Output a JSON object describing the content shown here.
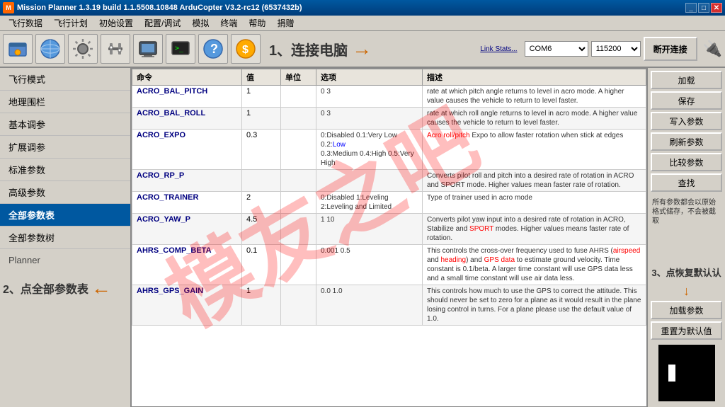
{
  "titleBar": {
    "title": "Mission Planner 1.3.19 build 1.1.5508.10848 ArduCopter V3.2-rc12 (6537432b)",
    "icon": "MP"
  },
  "menuBar": {
    "items": [
      "飞行数据",
      "飞行计划",
      "初始设置",
      "配置/调试",
      "模拟",
      "终端",
      "帮助",
      "捐赠"
    ]
  },
  "toolbar": {
    "icons": [
      {
        "name": "fly-data-icon",
        "symbol": "✈"
      },
      {
        "name": "flight-plan-icon",
        "symbol": "🌐"
      },
      {
        "name": "initial-setup-icon",
        "symbol": "⚙"
      },
      {
        "name": "config-icon",
        "symbol": "🔧"
      },
      {
        "name": "simulation-icon",
        "symbol": "🖥"
      },
      {
        "name": "terminal-icon",
        "symbol": "📟"
      },
      {
        "name": "help-icon",
        "symbol": "❓"
      },
      {
        "name": "donate-icon",
        "symbol": "💰"
      }
    ],
    "connectLabel": "1、连接电脑",
    "comPort": "COM6",
    "baudRate": "115200",
    "connectBtnLabel": "断开连接",
    "linkStats": "Link Stats..."
  },
  "sidebar": {
    "items": [
      {
        "label": "飞行模式",
        "active": false
      },
      {
        "label": "地理围栏",
        "active": false
      },
      {
        "label": "基本调参",
        "active": false
      },
      {
        "label": "扩展调参",
        "active": false
      },
      {
        "label": "标准参数",
        "active": false
      },
      {
        "label": "高级参数",
        "active": false
      },
      {
        "label": "全部参数表",
        "active": true
      },
      {
        "label": "全部参数树",
        "active": false
      }
    ],
    "plannerLabel": "Planner"
  },
  "tableHeaders": [
    "命令",
    "值",
    "单位",
    "选项",
    "描述"
  ],
  "tableRows": [
    {
      "name": "ACRO_BAL_PITCH",
      "value": "1",
      "unit": "",
      "options": "0 3",
      "description": "rate at which pitch angle returns to level in acro mode.  A higher value causes the vehicle to return to level faster."
    },
    {
      "name": "ACRO_BAL_ROLL",
      "value": "1",
      "unit": "",
      "options": "0 3",
      "description": "rate at which roll angle returns to level in acro mode.  A higher value causes the vehicle to return to level faster."
    },
    {
      "name": "ACRO_EXPO",
      "value": "0.3",
      "unit": "",
      "options": "0:Disabled 0.1:Very Low 0.2:Low 0.3:Medium 0.4:High 0.5:Very High",
      "description": "Acro roll/pitch Expo to allow faster rotation when stick at edges",
      "hasRedText": true,
      "redParts": [
        "Acro roll/pitch"
      ]
    },
    {
      "name": "ACRO_RP_P",
      "value": "",
      "unit": "",
      "options": "",
      "description": "Converts pilot roll and pitch into a desired rate of rotation in ACRO and SPORT mode.  Higher values mean faster rate of rotation."
    },
    {
      "name": "ACRO_TRAINER",
      "value": "2",
      "unit": "",
      "options": "0:Disabled 1:Leveling 2:Leveling and Limited",
      "description": "Type of trainer used in acro mode"
    },
    {
      "name": "ACRO_YAW_P",
      "value": "4.5",
      "unit": "",
      "options": "1 10",
      "description": "Converts pilot yaw input into a desired rate of rotation in ACRO, Stabilize and SPORT modes.  Higher values means faster rate of rotation.",
      "hasRedText": true,
      "redParts": [
        "SPORT"
      ]
    },
    {
      "name": "AHRS_COMP_BETA",
      "value": "0.1",
      "unit": "",
      "options": "0.001 0.5",
      "description": "This controls the cross-over frequency used to fuse AHRS (airspeed and heading) and GPS data to estimate ground velocity. Time constant is 0.1/beta. A larger time constant will use GPS data less and a small time constant will use air data less.",
      "hasRedText": true,
      "redParts": [
        "airspeed",
        "heading",
        "GPS data"
      ]
    },
    {
      "name": "AHRS_GPS_GAIN",
      "value": "1",
      "unit": "",
      "options": "0.0 1.0",
      "description": "This controls how much to use the GPS to correct the attitude. This should never be set to zero for a plane as it would result in the plane losing control in turns. For a plane please use the default value of 1.0."
    }
  ],
  "rightPanel": {
    "buttons": [
      {
        "label": "加载",
        "name": "load-btn"
      },
      {
        "label": "保存",
        "name": "save-btn"
      },
      {
        "label": "写入参数",
        "name": "write-params-btn"
      },
      {
        "label": "刷新参数",
        "name": "refresh-params-btn"
      },
      {
        "label": "比较参数",
        "name": "compare-params-btn"
      },
      {
        "label": "查找",
        "name": "find-btn"
      }
    ],
    "note": "所有参数都会以原始格式储存，不会被截取",
    "bottomButtons": [
      {
        "label": "加载参数",
        "name": "load-params-btn"
      },
      {
        "label": "重置为默认值",
        "name": "reset-default-btn"
      }
    ]
  },
  "annotations": {
    "step1": "1、连接电脑",
    "step2": "2、点全部参数表",
    "step3": "3、点恢复默认认"
  },
  "watermark": "模友之吧"
}
